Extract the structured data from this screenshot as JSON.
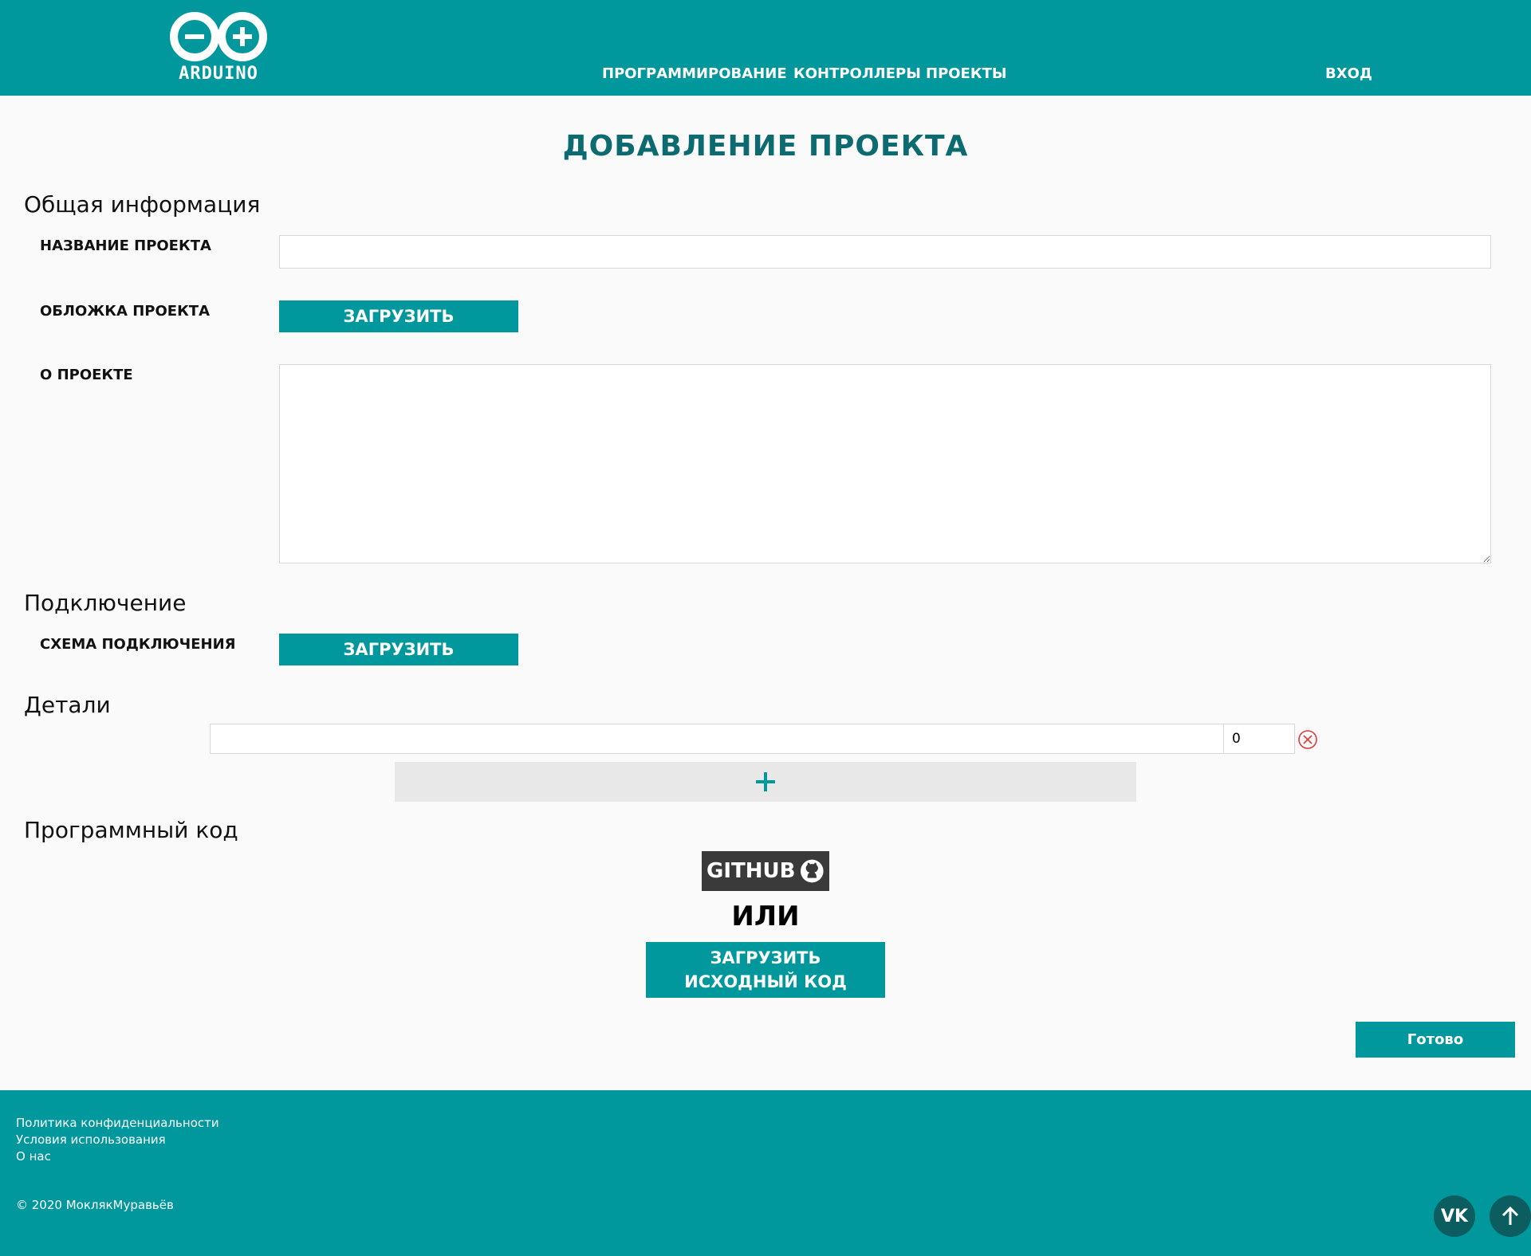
{
  "header": {
    "logo_text": "ARDUINO",
    "nav": {
      "programming": "ПРОГРАММИРОВАНИЕ",
      "controllers": "КОНТРОЛЛЕРЫ",
      "projects": "ПРОЕКТЫ",
      "login": "ВХОД"
    }
  },
  "page": {
    "title": "ДОБАВЛЕНИЕ ПРОЕКТА",
    "general": {
      "section_title": "Общая информация",
      "name_label": "НАЗВАНИЕ ПРОЕКТА",
      "name_value": "",
      "cover_label": "ОБЛОЖКА ПРОЕКТА",
      "cover_upload": "ЗАГРУЗИТЬ",
      "about_label": "О ПРОЕКТЕ",
      "about_value": ""
    },
    "connection": {
      "section_title": "Подключение",
      "scheme_label": "СХЕМА ПОДКЛЮЧЕНИЯ",
      "scheme_upload": "ЗАГРУЗИТЬ"
    },
    "details": {
      "section_title": "Детали",
      "rows": [
        {
          "name": "",
          "quantity": "0"
        }
      ],
      "add_icon": "plus-icon",
      "remove_icon": "remove-circle-icon"
    },
    "code": {
      "section_title": "Программный код",
      "github_label": "GITHUB",
      "github_icon": "github-icon",
      "or_text": "ИЛИ",
      "upload_source_label": "ЗАГРУЗИТЬ ИСХОДНЫЙ КОД"
    },
    "done_button": "Готово"
  },
  "footer": {
    "links": {
      "privacy": "Политика конфиденциальности",
      "terms": "Условия использования",
      "about": "О нас"
    },
    "copyright": "© 2020 МоклякМуравьёв",
    "social_vk_label": "VK",
    "to_top_icon": "arrow-up-icon"
  },
  "colors": {
    "primary": "#00979d",
    "title": "#0b6b70",
    "github": "#3a3a3a",
    "add_row_bg": "#e8e8e8",
    "remove": "#e53935"
  }
}
